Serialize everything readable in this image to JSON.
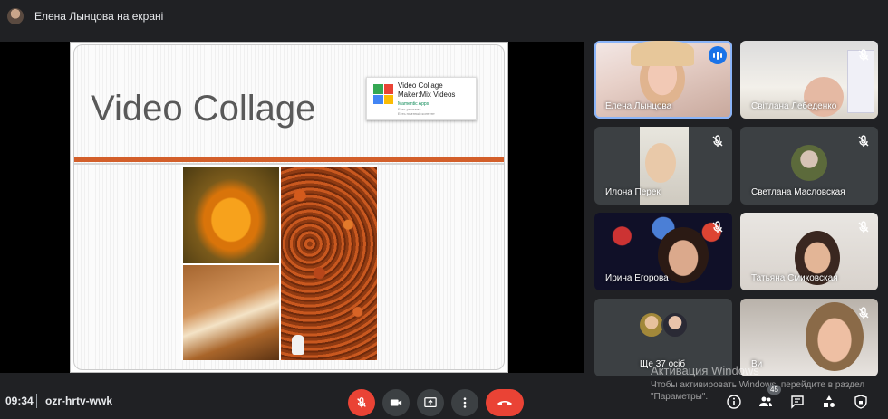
{
  "topbar": {
    "presenting_text": "Елена Лынцова на екрані"
  },
  "slide": {
    "title": "Video Collage",
    "app": {
      "name": "Video Collage Maker:Mix Videos",
      "developer": "Mamentic Apps",
      "note1": "Есть реклама",
      "note2": "Есть платный контент"
    }
  },
  "participants": [
    {
      "name": "Елена Лынцова",
      "speaking": true
    },
    {
      "name": "Світлана Лебеденко",
      "muted": true
    },
    {
      "name": "Илона Перек",
      "muted": true
    },
    {
      "name": "Светлана Масловская",
      "muted": true
    },
    {
      "name": "Ирина Егорова",
      "muted": true
    },
    {
      "name": "Татьяна Смиковская",
      "muted": true
    },
    {
      "name": "Ще 37 осіб"
    },
    {
      "name": "Ви",
      "muted": true
    }
  ],
  "bottombar": {
    "time": "09:34",
    "meeting_code": "ozr-hrtv-wwk",
    "participants_count": "45"
  },
  "watermark": {
    "title": "Активация Windows",
    "text": "Чтобы активировать Windows, перейдите в раздел \"Параметры\"."
  },
  "colors": {
    "accent": "#8ab4f8",
    "danger": "#ea4335",
    "speaking": "#1a73e8",
    "slide_bar": "#d35f2a"
  }
}
